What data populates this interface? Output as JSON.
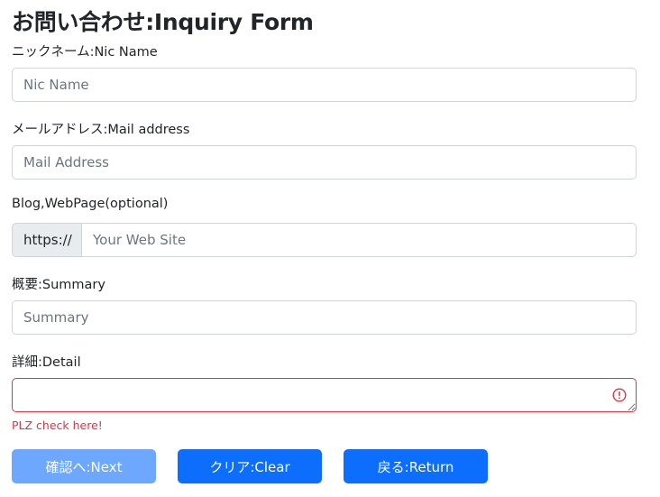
{
  "form": {
    "title": "お問い合わせ:Inquiry Form",
    "nickname": {
      "label": "ニックネーム:Nic Name",
      "placeholder": "Nic Name",
      "value": ""
    },
    "email": {
      "label": "メールアドレス:Mail address",
      "placeholder": "Mail Address",
      "value": ""
    },
    "website": {
      "label": "Blog,WebPage(optional)",
      "prefix": "https://",
      "placeholder": "Your Web Site",
      "value": ""
    },
    "summary": {
      "label": "概要:Summary",
      "placeholder": "Summary",
      "value": ""
    },
    "detail": {
      "label": "詳細:Detail",
      "value": "",
      "error": "PLZ check here!"
    }
  },
  "buttons": {
    "next": "確認へ:Next",
    "clear": "クリア:Clear",
    "return": "戻る:Return"
  },
  "colors": {
    "primary": "#0d6efd",
    "primary_disabled": "#6ea8fe",
    "danger": "#dc3545",
    "input_border": "#ced4da",
    "addon_bg": "#e9ecef"
  }
}
